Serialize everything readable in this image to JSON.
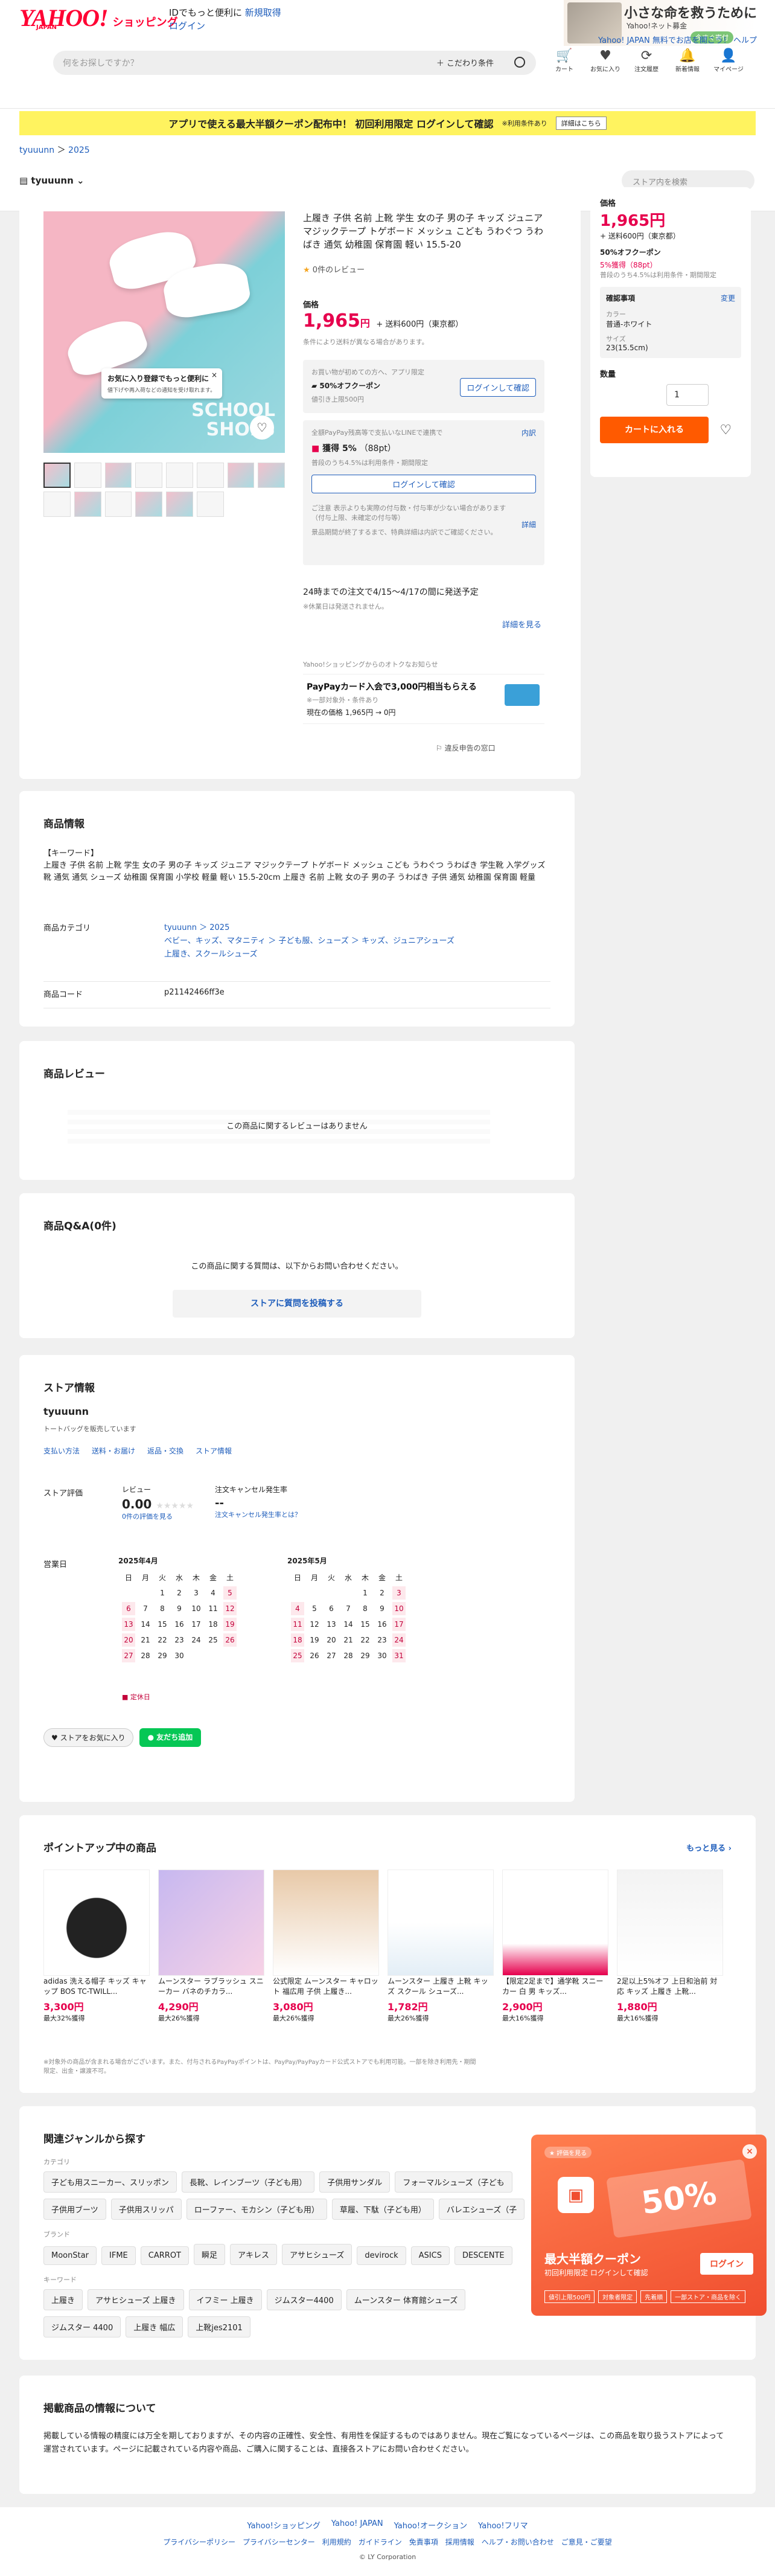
{
  "header": {
    "logo": "YAHOO!",
    "logo_sub": "JAPAN",
    "shopping": "ショッピング",
    "id_line": "IDでもっと便利に",
    "register": "新規取得",
    "login": "ログイン",
    "ad_title": "小さな命を救うために",
    "ad_org": "Yahoo!ネット募金",
    "ad_btn": "今すぐ寄付",
    "jp_line": "Yahoo! JAPAN  無料でお店を開こう！  ヘルプ",
    "search_placeholder": "何をお探しですか？",
    "search_cond": "こだわり条件",
    "icons": [
      {
        "label": "カート",
        "icon": "cart-icon"
      },
      {
        "label": "お気に入り",
        "icon": "heart-icon"
      },
      {
        "label": "注文履歴",
        "icon": "history-icon"
      },
      {
        "label": "新着情報",
        "icon": "bell-icon"
      },
      {
        "label": "マイページ",
        "icon": "user-icon"
      }
    ]
  },
  "promo": {
    "text": "アプリで使える最大半額クーポン配布中！ 初回利用限定  ログインして確認",
    "note": "※利用条件あり",
    "detail_btn": "詳細はこちら"
  },
  "breadcrumb": [
    "tyuuunn",
    "2025"
  ],
  "store": {
    "name": "tyuuunn",
    "search_placeholder": "ストア内を検索"
  },
  "product": {
    "image_text": "SCHOOL SHOES",
    "tip_title": "お気に入り登録でもっと便利に",
    "tip_sub": "値下げや再入荷などの通知を受け取れます。",
    "title": "上履き 子供 名前 上靴 学生 女の子 男の子 キッズ ジュニア マジックテープ トゲボード メッシュ こども うわぐつ うわばき 通気 幼稚園 保育園 軽い 15.5-20",
    "reviews": "0件のレビュー",
    "price_label": "価格",
    "price": "1,965",
    "price_unit": "円",
    "shipping": "+ 送料600円（東京都）",
    "price_note": "条件により送料が異なる場合があります。",
    "coupon_head": "お買い物が初めての方へ、アプリ限定",
    "coupon": "50%オフクーポン",
    "coupon_note": "値引き上限500円",
    "login_confirm": "ログインして確認",
    "pp_head": "全額PayPay残高等で支払いなLINEで連携で",
    "pp_detail": "内訳",
    "pp_gain": "獲得 5%",
    "pp_pt": "（88pt）",
    "pp_note": "普段のうち4.5%は利用条件・期間限定",
    "pp_login": "ログインして確認",
    "caution": "ご注意 表示よりも実際の付与数・付与率が少ない場合があります（付与上限、未確定の付与等）",
    "caution_more": "詳細",
    "caution2": "景品期間が終了するまで、特典詳細は内訳でご確認ください。",
    "ship_line": "24時までの注文で4/15〜4/17の間に発送予定",
    "ship_note": "※休業日は発送されません。",
    "more": "詳細を見る",
    "card_head": "Yahoo!ショッピングからのオトクなお知らせ",
    "card_title": "PayPayカード入会で3,000円相当もらえる",
    "card_sub": "※一部対象外・条件あり",
    "card_price": "現在の価格  1,965円 → 0円",
    "report": "違反申告の窓口"
  },
  "side": {
    "price_label": "価格",
    "price": "1,965円",
    "shipping": "+ 送料600円（東京都）",
    "coupon": "50%オフクーポン",
    "gain": "5%獲得（88pt）",
    "gain_note": "普段のうち4.5%は利用条件・期間限定",
    "confirm": "確認事項",
    "change": "変更",
    "color_label": "カラー",
    "color": "普通-ホワイト",
    "size_label": "サイズ",
    "size": "23(15.5cm)",
    "qty_label": "数量",
    "qty": "1",
    "cart": "カートに入れる"
  },
  "info": {
    "title": "商品情報",
    "keywords_label": "【キーワード】",
    "keywords": "上履き 子供 名前 上靴 学生 女の子 男の子 キッズ ジュニア マジックテープ トゲボード メッシュ こども うわぐつ うわばき 学生靴 入学グッズ 靴 通気 通気 シューズ 幼稚園 保育園 小学校 軽量 軽い 15.5-20cm 上履き 名前 上靴 女の子 男の子 うわばき 子供 通気 幼稚園 保育園 軽量",
    "cat_label": "商品カテゴリ",
    "cat1": "tyuuunn ＞ 2025",
    "cat2": "ベビー、キッズ、マタニティ ＞ 子ども服、シューズ ＞ キッズ、ジュニアシューズ",
    "cat3": "上履き、スクールシューズ",
    "code_label": "商品コード",
    "code": "p21142466ff3e"
  },
  "review": {
    "title": "商品レビュー",
    "empty": "この商品に関するレビューはありません"
  },
  "qa": {
    "title": "商品Q&A(0件)",
    "empty": "この商品に関する質問は、以下からお問い合わせください。",
    "btn": "ストアに質問を投稿する"
  },
  "storeinfo": {
    "title": "ストア情報",
    "name": "tyuuunn",
    "desc": "トートバッグを販売しています",
    "links": [
      "支払い方法",
      "送料・お届け",
      "返品・交換",
      "ストア情報"
    ],
    "rating_label": "ストア評価",
    "review_label": "レビュー",
    "score": "0.00",
    "rating_link": "0件の評価を見る",
    "cancel_label": "注文キャンセル発生率",
    "cancel": "--",
    "cancel_link": "注文キャンセル発生率とは？",
    "biz_label": "営業日",
    "months": [
      "2025年4月",
      "2025年5月"
    ],
    "weekdays": [
      "日",
      "月",
      "火",
      "水",
      "木",
      "金",
      "土"
    ],
    "april": [
      "",
      "",
      "1",
      "2",
      "3",
      "4",
      "5",
      "6",
      "7",
      "8",
      "9",
      "10",
      "11",
      "12",
      "13",
      "14",
      "15",
      "16",
      "17",
      "18",
      "19",
      "20",
      "21",
      "22",
      "23",
      "24",
      "25",
      "26",
      "27",
      "28",
      "29",
      "30",
      "",
      "",
      ""
    ],
    "may": [
      "",
      "",
      "",
      "",
      "1",
      "2",
      "3",
      "4",
      "5",
      "6",
      "7",
      "8",
      "9",
      "10",
      "11",
      "12",
      "13",
      "14",
      "15",
      "16",
      "17",
      "18",
      "19",
      "20",
      "21",
      "22",
      "23",
      "24",
      "25",
      "26",
      "27",
      "28",
      "29",
      "30",
      "31"
    ],
    "holiday_note": "定休日",
    "fav_btn": "ストアをお気に入り",
    "friend_btn": "友だち追加"
  },
  "pointup": {
    "title": "ポイントアップ中の商品",
    "more": "もっと見る",
    "items": [
      {
        "name": "adidas 洗える帽子 キッズ キャップ BOS TC-TWILL...",
        "price": "3,300円",
        "pct": "最大32%獲得"
      },
      {
        "name": "ムーンスター ラブラッシュ スニーカー バネのチカラ...",
        "price": "4,290円",
        "pct": "最大26%獲得"
      },
      {
        "name": "公式限定 ムーンスター キャロット 福広用 子供 上履き...",
        "price": "3,080円",
        "pct": "最大26%獲得"
      },
      {
        "name": "ムーンスター 上履き 上靴 キッズ スクール シューズ...",
        "price": "1,782円",
        "pct": "最大26%獲得"
      },
      {
        "name": "【限定2足まで】通学靴 スニーカー 白 男 キッズ...",
        "price": "2,900円",
        "pct": "最大16%獲得"
      },
      {
        "name": "2足以上5%オフ 上日和治前 対応 キッズ 上履き 上靴...",
        "price": "1,880円",
        "pct": "最大16%獲得"
      }
    ],
    "note": "※対象外の商品が含まれる場合がございます。また、付与されるPayPayポイントは、PayPay/PayPayカード公式ストアでも利用可能。一部を除き利用先・期間限定、出金・譲渡不可。"
  },
  "related": {
    "title": "関連ジャンルから探す",
    "cat_label": "カテゴリ",
    "cats": [
      "子ども用スニーカー、スリッポン",
      "長靴、レインブーツ（子ども用）",
      "子供用サンダル",
      "フォーマルシューズ（子ども",
      "子供用ブーツ",
      "子供用スリッパ",
      "ローファー、モカシン（子ども用）",
      "草履、下駄（子ども用）",
      "バレエシューズ（子"
    ],
    "brand_label": "ブランド",
    "brands": [
      "MoonStar",
      "IFME",
      "CARROT",
      "瞬足",
      "アキレス",
      "アサヒシューズ",
      "devirock",
      "ASICS",
      "DESCENTE"
    ],
    "kw_label": "キーワード",
    "keywords": [
      "上履き",
      "アサヒシューズ 上履き",
      "イフミー 上履き",
      "ジムスター4400",
      "ムーンスター 体育館シューズ",
      "ジムスター 4400",
      "上履き 幅広",
      "上靴jes2101"
    ]
  },
  "disclaimer": {
    "title": "掲載商品の情報について",
    "text": "掲載している情報の精度には万全を期しておりますが、その内容の正確性、安全性、有用性を保証するものではありません。現在ご覧になっているページは、この商品を取り扱うストアによって運営されています。ページに記載されている内容や商品、ご購入に関することは、直接各ストアにお問い合わせください。"
  },
  "popup": {
    "badge": "評価を見る",
    "big": "50%",
    "title": "最大半額クーポン",
    "sub": "初回利用限定 ログインして確認",
    "login": "ログイン",
    "tags": [
      "値引上限500円",
      "対象者限定",
      "先着順",
      "一部ストア・商品を除く"
    ]
  },
  "footer": {
    "links1": [
      "Yahoo!ショッピング",
      "Yahoo! JAPAN",
      "Yahoo!オークション",
      "Yahoo!フリマ"
    ],
    "links2": [
      "プライバシーポリシー",
      "プライバシーセンター",
      "利用規約",
      "ガイドライン",
      "免責事項",
      "採用情報",
      "ヘルプ・お問い合わせ",
      "ご意見・ご要望"
    ],
    "copyright": "© LY Corporation"
  }
}
